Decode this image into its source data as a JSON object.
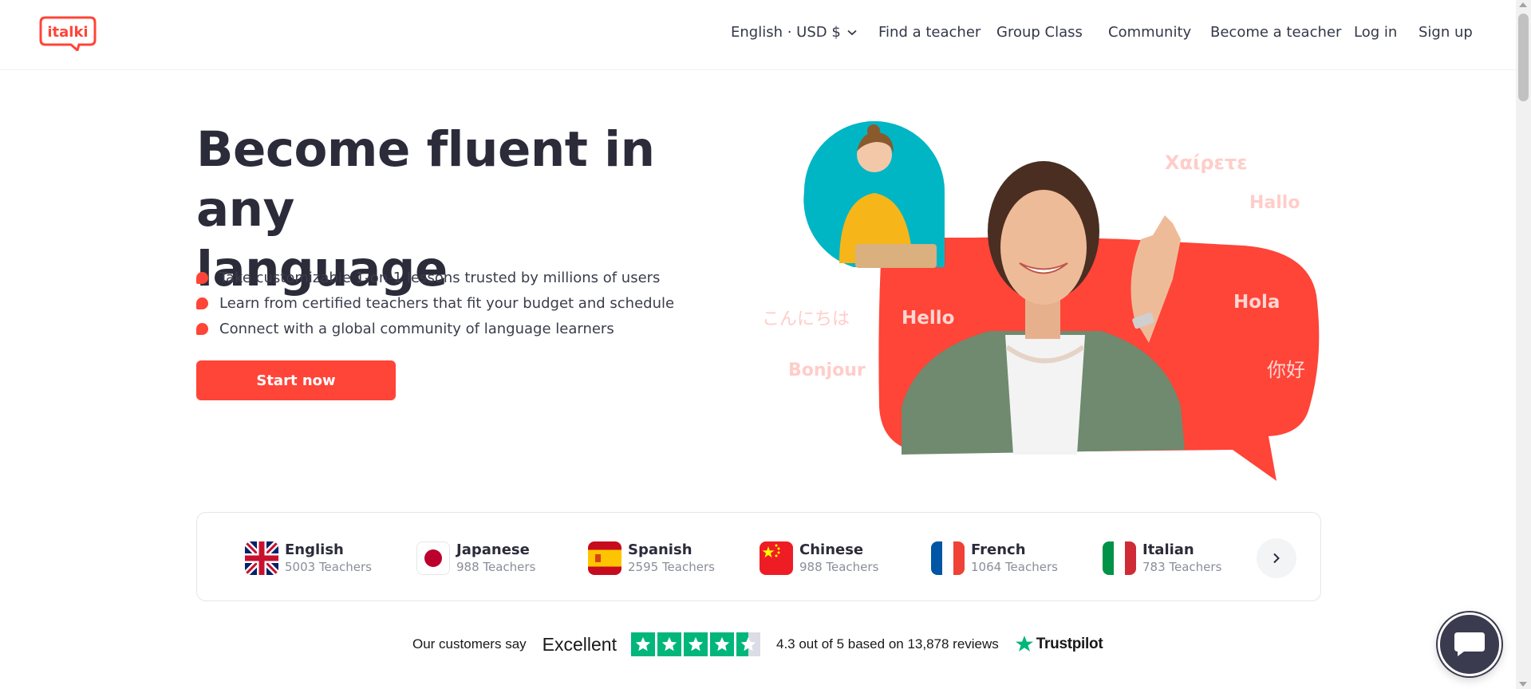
{
  "header": {
    "logo_text": "italki",
    "nav": {
      "language_currency": "English · USD $",
      "find_teacher": "Find a teacher",
      "group_class": "Group Class",
      "community": "Community",
      "become_teacher": "Become a teacher",
      "login": "Log in",
      "signup": "Sign up"
    }
  },
  "hero": {
    "title_line1": "Become fluent in any",
    "title_line2": "language",
    "bullets": [
      "Take customizable 1-on-1 lessons trusted by millions of users",
      "Learn from certified teachers that fit your budget and schedule",
      "Connect with a global community of language learners"
    ],
    "cta": "Start now",
    "greetings": {
      "greek": "Χαίρετε",
      "german": "Hallo",
      "japanese": "こんにちは",
      "english": "Hello",
      "spanish": "Hola",
      "chinese": "你好",
      "french": "Bonjour"
    }
  },
  "languages": [
    {
      "name": "English",
      "count": "5003 Teachers",
      "flag": "uk-flag-icon"
    },
    {
      "name": "Japanese",
      "count": "988 Teachers",
      "flag": "japan-flag-icon"
    },
    {
      "name": "Spanish",
      "count": "2595 Teachers",
      "flag": "spain-flag-icon"
    },
    {
      "name": "Chinese",
      "count": "988 Teachers",
      "flag": "china-flag-icon"
    },
    {
      "name": "French",
      "count": "1064 Teachers",
      "flag": "france-flag-icon"
    },
    {
      "name": "Italian",
      "count": "783 Teachers",
      "flag": "italy-flag-icon"
    }
  ],
  "trustpilot": {
    "say": "Our customers say",
    "rating_word": "Excellent",
    "score_text": "4.3 out of 5 based on 13,878 reviews",
    "brand": "Trustpilot",
    "stars": 4.5
  },
  "colors": {
    "brand": "#ff4438",
    "text": "#2b2b3a",
    "trust_green": "#00b67a",
    "teal": "#00b5c4"
  }
}
